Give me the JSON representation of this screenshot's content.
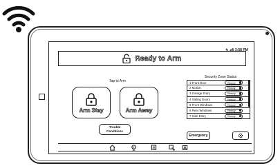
{
  "status_bar": {
    "time": "↯ .all 3:58 PM"
  },
  "banner": {
    "text": "Ready to Arm",
    "icon": "padlock-open-icon"
  },
  "arm_panel": {
    "tap_label": "Tap to Arm",
    "arm_stay_label": "Arm Stay",
    "arm_away_label": "Arm Away",
    "trouble_label_line1": "Trouble",
    "trouble_label_line2": "Conditions"
  },
  "zones": {
    "title": "Security Zone Status",
    "items": [
      {
        "name": "1 Front Door",
        "status": "Ready"
      },
      {
        "name": "2 Motion",
        "status": "Ready"
      },
      {
        "name": "3 Garage Entry",
        "status": "Ready"
      },
      {
        "name": "4 Sliding Doors",
        "status": "Ready"
      },
      {
        "name": "5 Front Windows",
        "status": "Ready"
      },
      {
        "name": "6 Rear Windows",
        "status": "Ready"
      },
      {
        "name": "7 Side Entry",
        "status": "Ready"
      }
    ]
  },
  "actions": {
    "emergency_label": "Emergency",
    "settings_icon": "gear-icon"
  },
  "nav": [
    "home-icon",
    "camera-icon",
    "scenes-icon",
    "rules-icon",
    "users-icon"
  ]
}
